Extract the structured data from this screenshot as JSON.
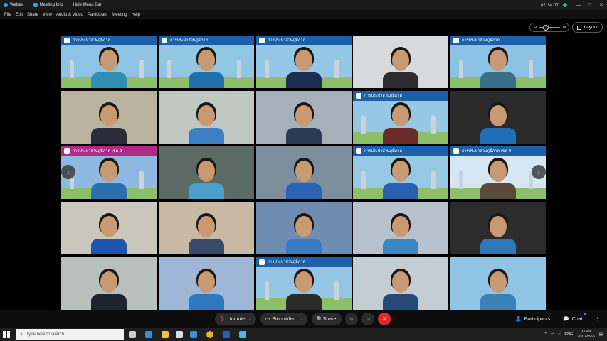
{
  "window": {
    "app_name": "Webex",
    "meeting_info_label": "Meeting Info",
    "hide_menu_label": "Hide Menu Bar",
    "time": "02:34:07",
    "controls": [
      "—",
      "□",
      "✕"
    ]
  },
  "menu": {
    "items": [
      "File",
      "Edit",
      "Share",
      "View",
      "Audio & Video",
      "Participant",
      "Meeting",
      "Help"
    ]
  },
  "view": {
    "layout_label": "Layout",
    "zoom_out": "⊖",
    "zoom_in": "⊕"
  },
  "tiles": [
    {
      "bg": "#8fc3e6",
      "banner": "การประปาส่วนภูมิภาค",
      "banner_color": "#1d5fa8",
      "person": "#2f8fb2"
    },
    {
      "bg": "#92c7e4",
      "banner": "การประปาส่วนภูมิภาค",
      "banner_color": "#1d5fa8",
      "person": "#1f6fa8"
    },
    {
      "bg": "#95c8e6",
      "banner": "การประปาส่วนภูมิภาค",
      "banner_color": "#1d5fa8",
      "person": "#1c2c52"
    },
    {
      "bg": "#d7d9db",
      "banner": "",
      "banner_color": "",
      "person": "#2e2a30"
    },
    {
      "bg": "#8ec2e4",
      "banner": "การประปาส่วนภูมิภาค",
      "banner_color": "#1d5fa8",
      "person": "#3a6f8a"
    },
    {
      "bg": "#b9b39f",
      "banner": "",
      "banner_color": "",
      "person": "#2b2b3a"
    },
    {
      "bg": "#bfc7c2",
      "banner": "",
      "banner_color": "",
      "person": "#3b7fc2"
    },
    {
      "bg": "#a6b0b8",
      "banner": "",
      "banner_color": "",
      "person": "#2c3b52"
    },
    {
      "bg": "#96c8e5",
      "banner": "การประปาส่วนภูมิภาค",
      "banner_color": "#1d5fa8",
      "person": "#6a2b2b"
    },
    {
      "bg": "#2a2a2a",
      "banner": "",
      "banner_color": "",
      "person": "#1f6fb5"
    },
    {
      "bg": "#8eb8e0",
      "banner": "การประปาส่วนภูมิภาค เขต 9",
      "banner_color": "#b02a8a",
      "person": "#2a6fb0"
    },
    {
      "bg": "#5c6a66",
      "banner": "",
      "banner_color": "",
      "person": "#4aa0c8"
    },
    {
      "bg": "#7d8e9e",
      "banner": "",
      "banner_color": "",
      "person": "#2d63b5"
    },
    {
      "bg": "#97c9e5",
      "banner": "การประปาส่วนภูมิภาค",
      "banner_color": "#1d5fa8",
      "person": "#2b5fb2"
    },
    {
      "bg": "#d6e7f3",
      "banner": "การประปาส่วนภูมิภาค เขต 9",
      "banner_color": "#1d5fa8",
      "person": "#5a4a3a"
    },
    {
      "bg": "#cbc7bd",
      "banner": "",
      "banner_color": "",
      "person": "#1f55b0"
    },
    {
      "bg": "#c9b9a4",
      "banner": "",
      "banner_color": "",
      "person": "#3a4a6a"
    },
    {
      "bg": "#6f8db0",
      "banner": "",
      "banner_color": "",
      "person": "#3a7cc2"
    },
    {
      "bg": "#b7c2cc",
      "banner": "",
      "banner_color": "",
      "person": "#3b86c4"
    },
    {
      "bg": "#2c2c2c",
      "banner": "",
      "banner_color": "",
      "person": "#2f78b8"
    },
    {
      "bg": "#b8c0bd",
      "banner": "",
      "banner_color": "",
      "person": "#1d2430"
    },
    {
      "bg": "#9fb7d6",
      "banner": "",
      "banner_color": "",
      "person": "#2d78c0"
    },
    {
      "bg": "#95c7e4",
      "banner": "การประปาส่วนภูมิภาค",
      "banner_color": "#1d5fa8",
      "person": "#2b2b2b"
    },
    {
      "bg": "#c4cdd4",
      "banner": "",
      "banner_color": "",
      "person": "#264a78"
    },
    {
      "bg": "#90c4e5",
      "banner": "",
      "banner_color": "",
      "person": "#3a80b5"
    }
  ],
  "toolbar": {
    "unmute": "Unmute",
    "stop_video": "Stop video",
    "share": "Share",
    "participants": "Participants",
    "chat": "Chat",
    "more": "···",
    "leave": "✕"
  },
  "taskbar": {
    "search_placeholder": "Type here to search",
    "lang": "ENG",
    "time": "11:49",
    "date": "20/1/2565",
    "icons": [
      {
        "name": "task-view-icon",
        "color": "#cfcfcf"
      },
      {
        "name": "edge-icon",
        "color": "#2f8fe0"
      },
      {
        "name": "file-explorer-icon",
        "color": "#f3c13a"
      },
      {
        "name": "store-icon",
        "color": "#dcdcdc"
      },
      {
        "name": "mail-icon",
        "color": "#3a8fe0"
      },
      {
        "name": "chrome-icon",
        "color": "#e8b32a"
      },
      {
        "name": "word-icon",
        "color": "#2b5fb5"
      },
      {
        "name": "webex-icon",
        "color": "#4fb3e8"
      }
    ]
  }
}
